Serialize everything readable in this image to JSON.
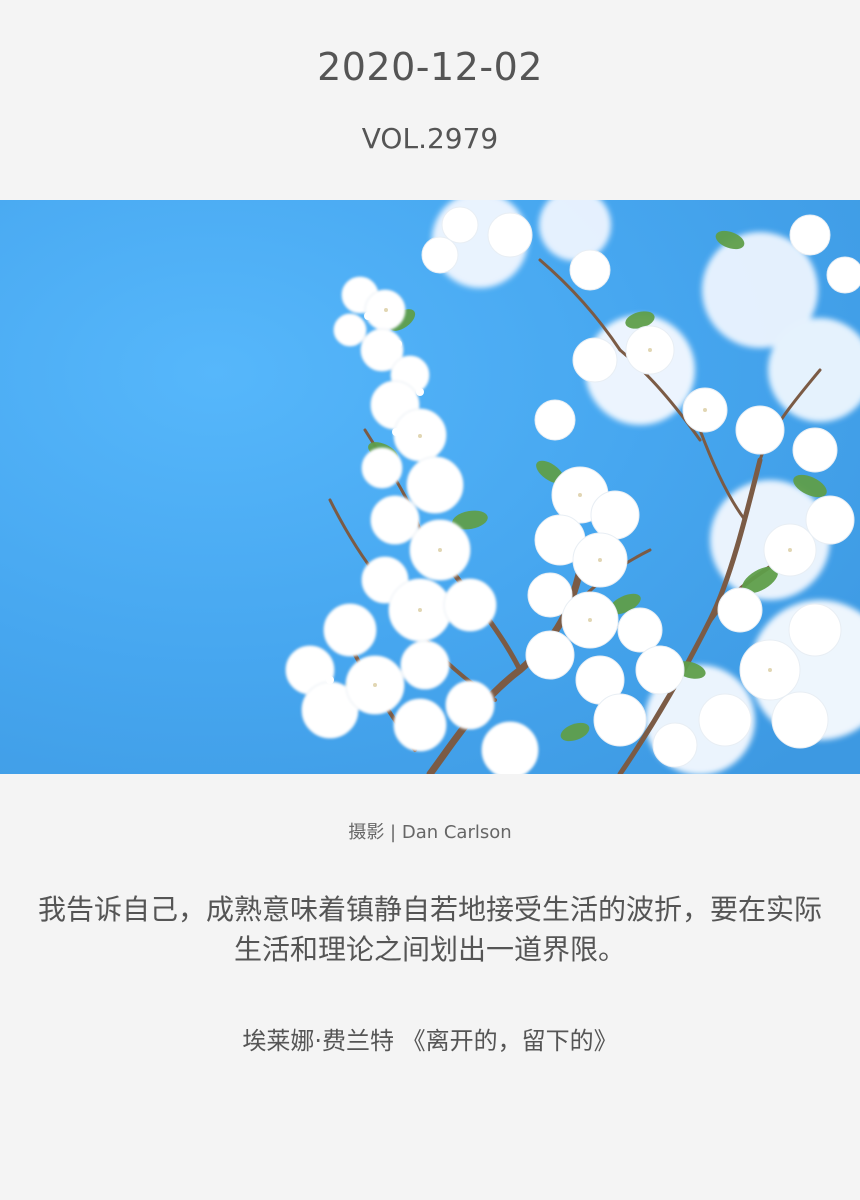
{
  "header": {
    "date": "2020-12-02",
    "volume": "VOL.2979"
  },
  "photo": {
    "credit": "摄影 | Dan Carlson"
  },
  "quote": {
    "text": "我告诉自己，成熟意味着镇静自若地接受生活的波折，要在实际生活和理论之间划出一道界限。",
    "source": "埃莱娜·费兰特 《离开的，留下的》"
  },
  "colors": {
    "background": "#f4f4f4",
    "text": "#555555",
    "sky": "#4aa8ef",
    "blossom": "#ffffff",
    "leaf": "#5f9f4a",
    "branch": "#7b5b45"
  }
}
